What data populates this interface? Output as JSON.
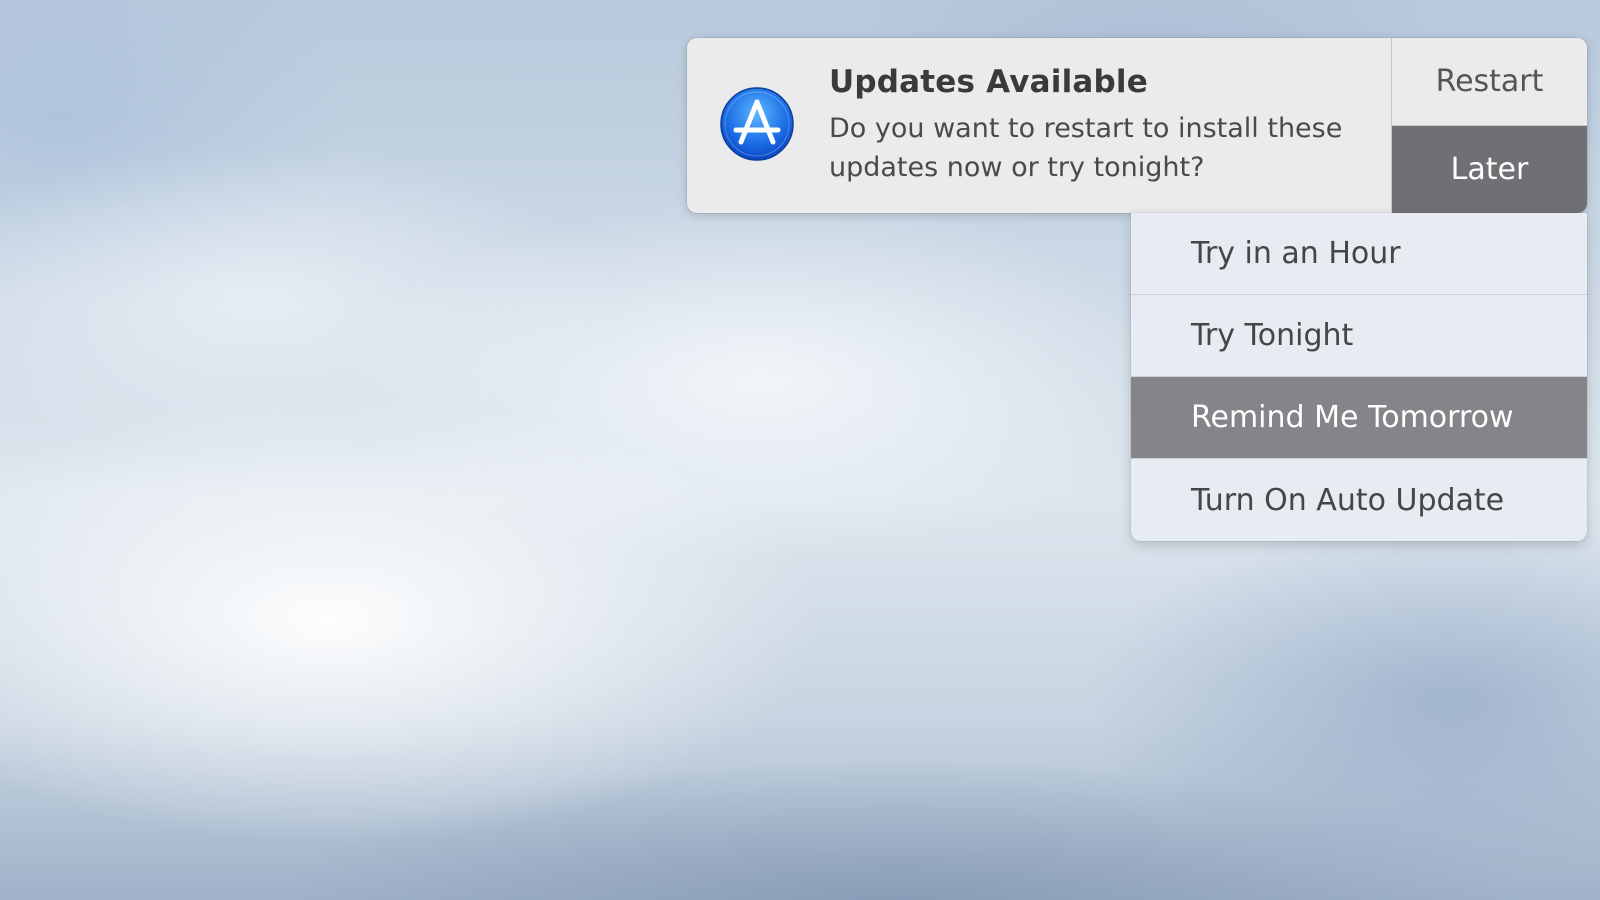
{
  "notification": {
    "app_icon": "app-store-icon",
    "title": "Updates Available",
    "message": "Do you want to restart to install these updates now or try tonight?",
    "actions": {
      "restart_label": "Restart",
      "later_label": "Later"
    }
  },
  "later_menu": {
    "items": [
      {
        "label": "Try in an Hour"
      },
      {
        "label": "Try Tonight"
      },
      {
        "label": "Remind Me Tomorrow",
        "selected": true
      },
      {
        "label": "Turn On Auto Update"
      }
    ]
  },
  "colors": {
    "icon_blue": "#1f72e8",
    "later_button_bg": "#707074",
    "selected_item_bg": "#858589",
    "banner_bg": "#ebebeb",
    "menu_bg": "#e7ecf2"
  }
}
